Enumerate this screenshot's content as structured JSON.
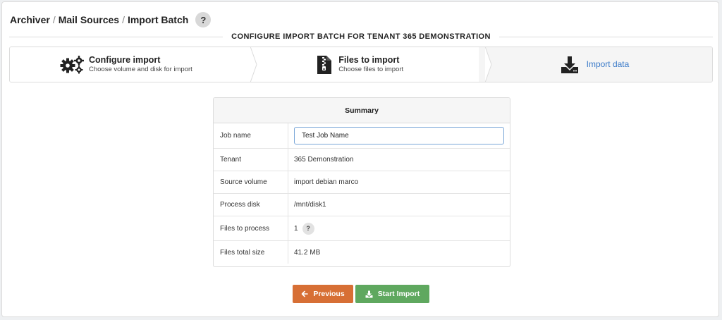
{
  "breadcrumb": {
    "items": [
      "Archiver",
      "Mail Sources",
      "Import Batch"
    ],
    "separator": "/",
    "help": "?"
  },
  "section_title": "CONFIGURE IMPORT BATCH FOR TENANT 365 DEMONSTRATION",
  "steps": [
    {
      "title": "Configure import",
      "subtitle": "Choose volume and disk for import",
      "icon": "gears-icon"
    },
    {
      "title": "Files to import",
      "subtitle": "Choose files to import",
      "icon": "zip-file-icon"
    },
    {
      "title": "Import data",
      "subtitle": "",
      "icon": "download-icon",
      "active": true
    }
  ],
  "summary": {
    "title": "Summary",
    "job_name_label": "Job name",
    "job_name_value": "Test Job Name",
    "rows": [
      {
        "label": "Tenant",
        "value": "365 Demonstration"
      },
      {
        "label": "Source volume",
        "value": "import debian marco"
      },
      {
        "label": "Process disk",
        "value": "/mnt/disk1"
      },
      {
        "label": "Files to process",
        "value": "1",
        "help": "?"
      },
      {
        "label": "Files total size",
        "value": "41.2 MB"
      }
    ]
  },
  "buttons": {
    "previous": "Previous",
    "start_import": "Start Import"
  },
  "colors": {
    "accent": "#3d7cc9",
    "previous_button": "#d76f35",
    "start_button": "#5fa85f"
  }
}
